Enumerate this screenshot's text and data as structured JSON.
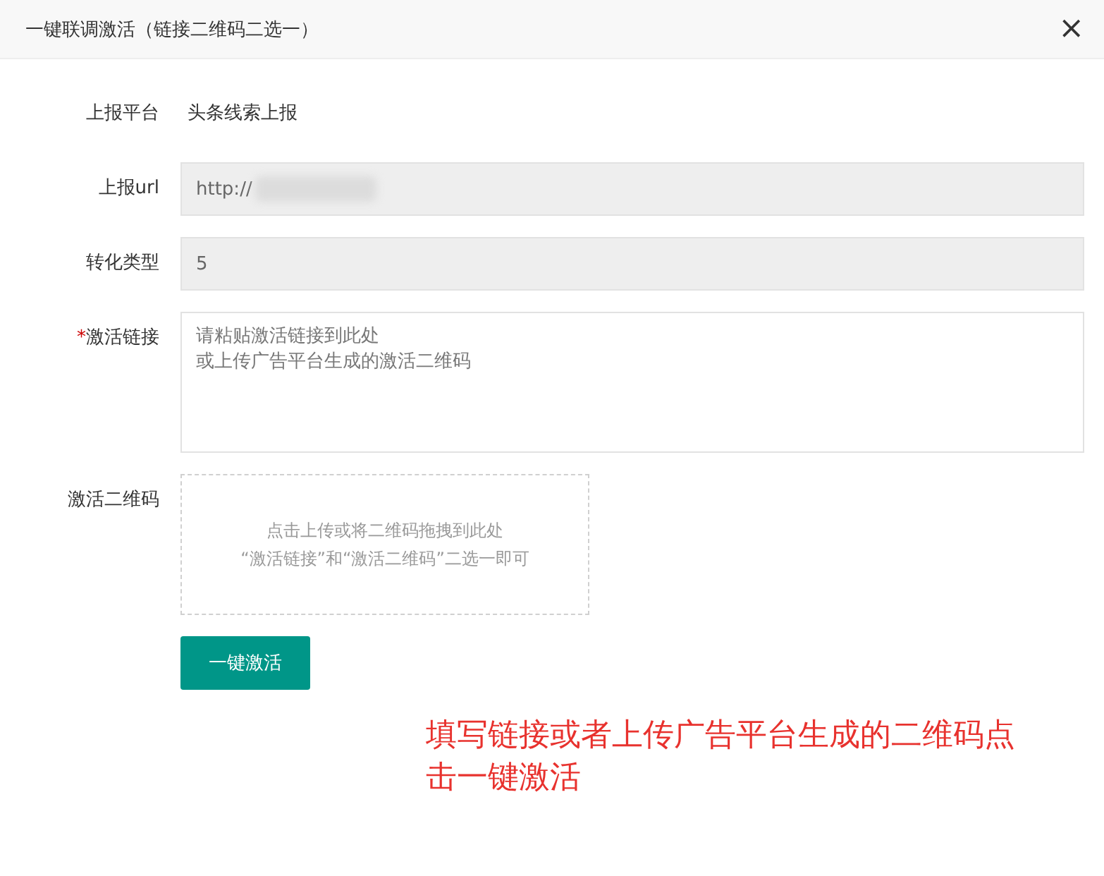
{
  "dialog": {
    "title": "一键联调激活（链接二维码二选一）",
    "close": "×"
  },
  "fields": [
    {
      "kind": "text",
      "label": "上报平台",
      "value": "头条线索上报"
    },
    {
      "kind": "input",
      "label": "上报url",
      "value": "http://",
      "redacted": true,
      "disabled": true
    },
    {
      "kind": "input",
      "label": "转化类型",
      "value": "5",
      "disabled": true
    },
    {
      "kind": "textarea",
      "label": "激活链接",
      "required_mark": "*",
      "placeholder_lines": [
        "请粘贴激活链接到此处",
        "或上传广告平台生成的激活二维码"
      ]
    },
    {
      "kind": "upload",
      "label": "激活二维码",
      "hint_lines": [
        "点击上传或将二维码拖拽到此处",
        "“激活链接”和“激活二维码”二选一即可"
      ]
    }
  ],
  "submit_button": "一键激活",
  "annotation": "填写链接或者上传广告平台生成的二维码点击一键激活"
}
